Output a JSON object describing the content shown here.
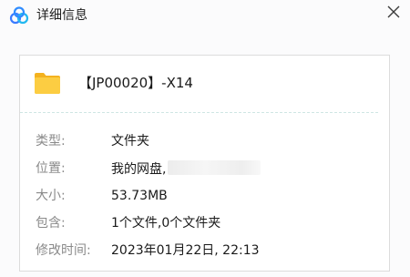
{
  "window": {
    "title": "详细信息",
    "brand_color": "#3a7bff"
  },
  "file": {
    "name": "【JP00020】-X14",
    "icon": "folder-icon",
    "icon_color": "#f8c53a"
  },
  "details": [
    {
      "label": "类型:",
      "value": "文件夹"
    },
    {
      "label": "位置:",
      "value": "我的网盘,"
    },
    {
      "label": "大小:",
      "value": "53.73MB"
    },
    {
      "label": "包含:",
      "value": "1个文件,0个文件夹"
    },
    {
      "label": "修改时间:",
      "value": "2023年01月22日, 22:13"
    }
  ]
}
